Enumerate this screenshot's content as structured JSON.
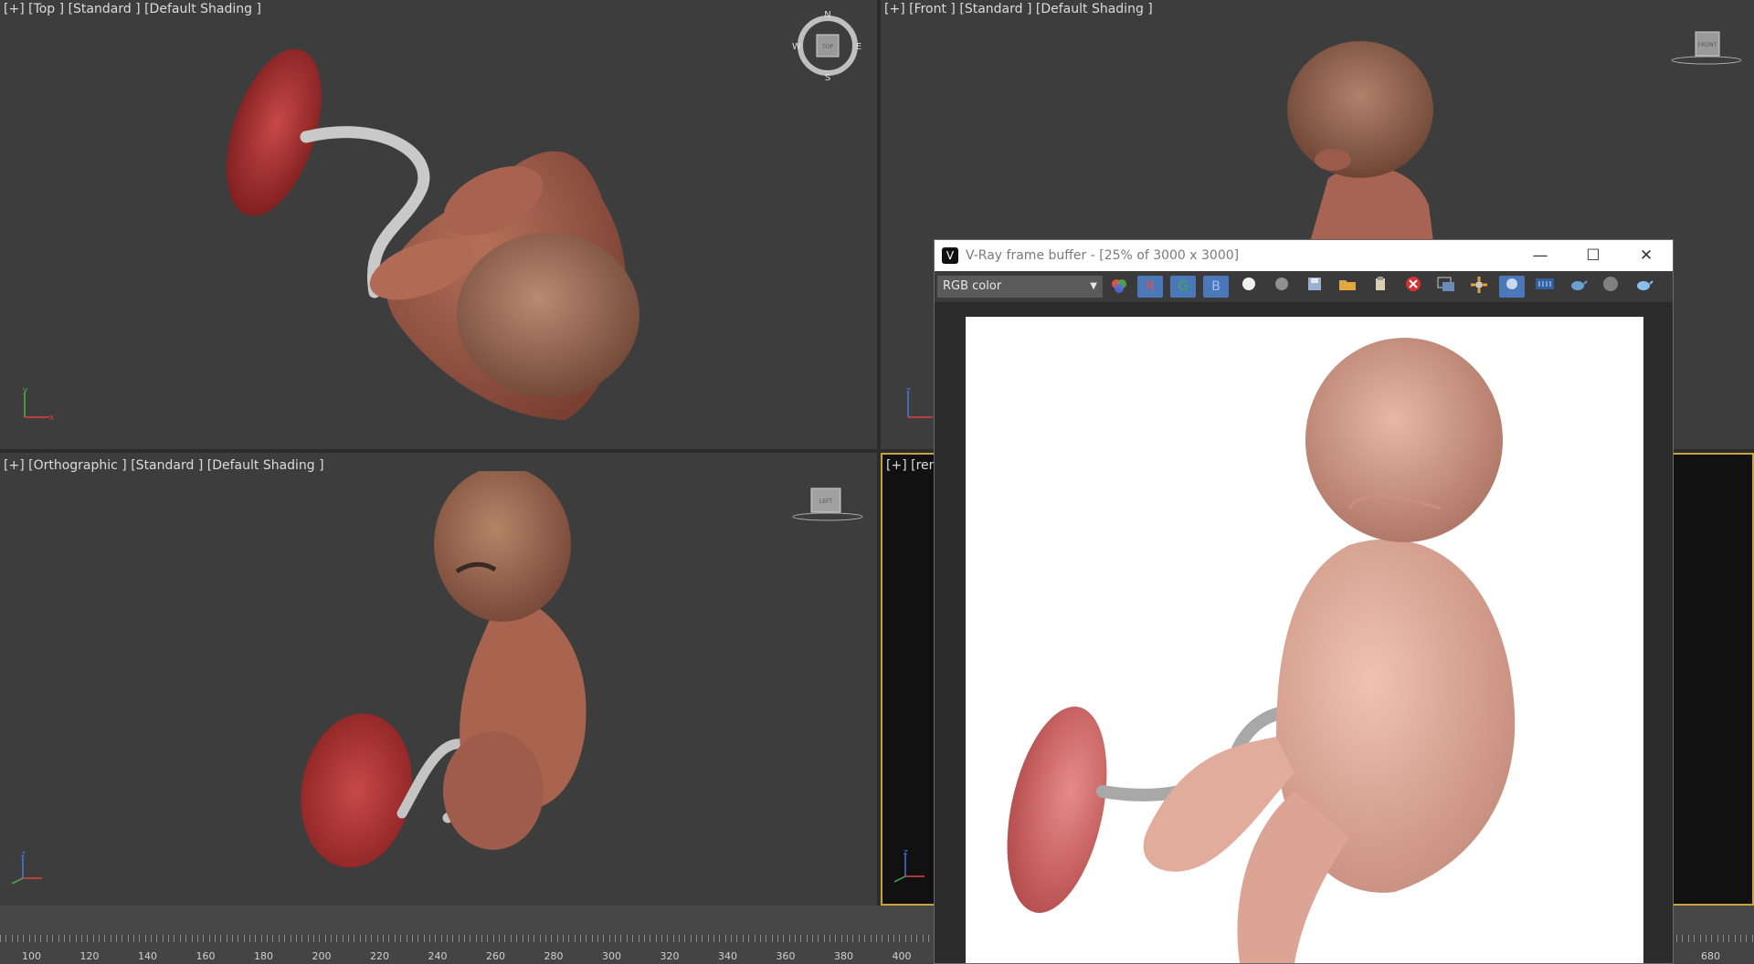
{
  "viewports": {
    "top": {
      "plus": "[+]",
      "view": "[Top ]",
      "shading": "[Standard ]",
      "mode": "[Default Shading ]"
    },
    "front": {
      "plus": "[+]",
      "view": "[Front ]",
      "shading": "[Standard ]",
      "mode": "[Default Shading ]"
    },
    "ortho": {
      "plus": "[+]",
      "view": "[Orthographic ]",
      "shading": "[Standard ]",
      "mode": "[Default Shading ]"
    },
    "render": {
      "plus": "[+]",
      "view": "[ren"
    }
  },
  "compass": {
    "n": "N",
    "s": "S",
    "e": "E",
    "w": "W",
    "face": "TOP"
  },
  "viewcube_front": {
    "face": "FRONT"
  },
  "viewcube_ortho": {
    "face": "LEFT"
  },
  "axes": {
    "x": "x",
    "y": "y",
    "z": "z"
  },
  "vfb": {
    "title": "V-Ray frame buffer - [25% of 3000 x 3000]",
    "logo": "V",
    "minimize": "—",
    "maximize": "☐",
    "close": "✕",
    "channel": "RGB color",
    "btn_r": "R",
    "btn_g": "G",
    "btn_b": "B"
  },
  "ruler": {
    "labels": [
      "100",
      "120",
      "140",
      "160",
      "180",
      "200",
      "220",
      "240",
      "260",
      "280",
      "300",
      "320",
      "340",
      "360",
      "380",
      "400",
      "680"
    ]
  },
  "colors": {
    "viewport_bg": "#3d3d3d",
    "active_border": "#c8a23a",
    "channel_active": "#4a78b8",
    "skin": "#b0705a",
    "placenta": "#c03a3a",
    "cord": "#c8c8c8"
  }
}
